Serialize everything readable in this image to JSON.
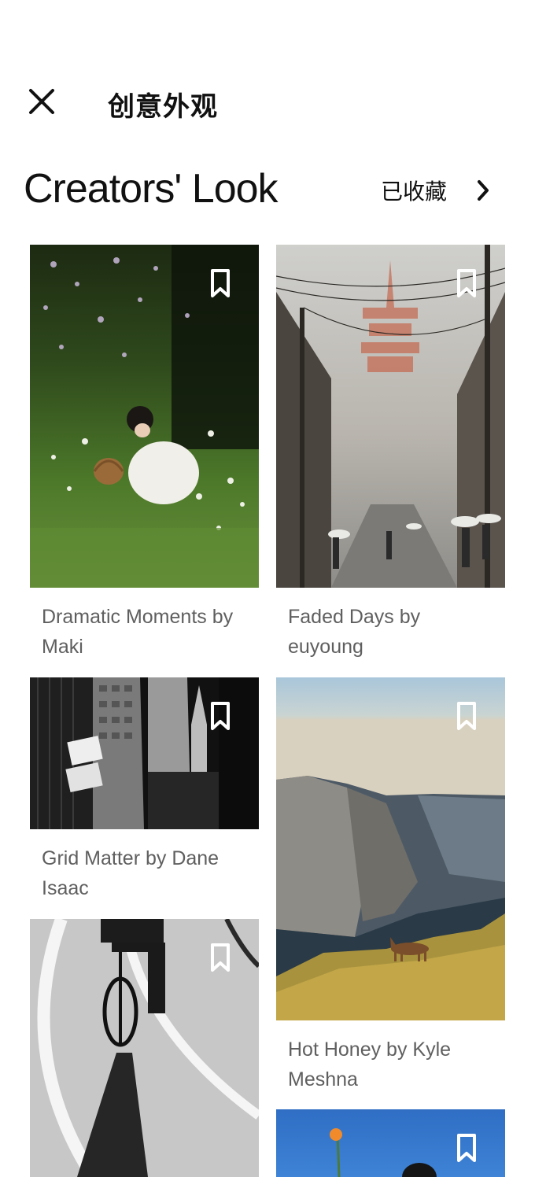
{
  "header": {
    "title": "创意外观",
    "close_icon": "close-icon"
  },
  "section": {
    "heading": "Creators' Look",
    "saved_label": "已收藏",
    "saved_icon": "chevron-right-icon"
  },
  "cards": [
    {
      "caption": "Dramatic Moments by Maki",
      "bookmark_icon": "bookmark-icon"
    },
    {
      "caption": "Faded Days by euyoung",
      "bookmark_icon": "bookmark-icon"
    },
    {
      "caption": "Grid Matter by Dane Isaac",
      "bookmark_icon": "bookmark-icon"
    },
    {
      "caption": "Hot Honey by Kyle Meshna",
      "bookmark_icon": "bookmark-icon"
    },
    {
      "caption": "",
      "bookmark_icon": "bookmark-icon"
    },
    {
      "caption": "",
      "bookmark_icon": "bookmark-icon"
    }
  ]
}
